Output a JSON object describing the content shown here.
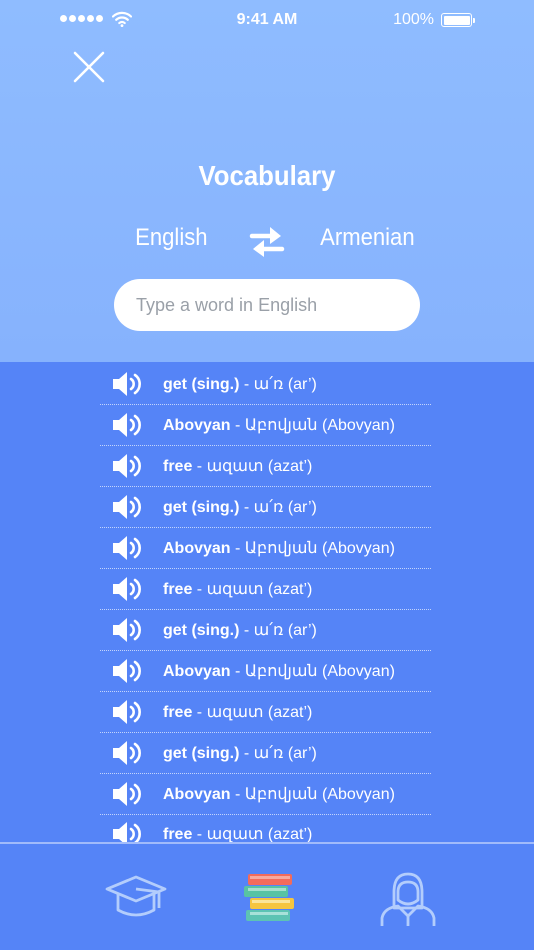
{
  "status_bar": {
    "time": "9:41 AM",
    "battery_percent": "100%",
    "battery_level": 1.0
  },
  "header": {
    "title": "Vocabulary",
    "source_language": "English",
    "target_language": "Armenian",
    "search_placeholder": "Type a word in English"
  },
  "vocab_list": [
    {
      "word": "get (sing.)",
      "rest": " - ա՛ռ (ar’)"
    },
    {
      "word": "Abovyan",
      "rest": " - Աբովյան (Abovyan)"
    },
    {
      "word": "free",
      "rest": " - ազատ (azat’)"
    },
    {
      "word": "get (sing.)",
      "rest": " - ա՛ռ (ar’)"
    },
    {
      "word": "Abovyan",
      "rest": " - Աբովյան (Abovyan)"
    },
    {
      "word": "free",
      "rest": " - ազատ (azat’)"
    },
    {
      "word": "get (sing.)",
      "rest": " - ա՛ռ (ar’)"
    },
    {
      "word": "Abovyan",
      "rest": " - Աբովյան (Abovyan)"
    },
    {
      "word": "free",
      "rest": " - ազատ (azat’)"
    },
    {
      "word": "get (sing.)",
      "rest": " - ա՛ռ (ar’)"
    },
    {
      "word": "Abovyan",
      "rest": " - Աբովյան (Abovyan)"
    },
    {
      "word": "free",
      "rest": " - ազատ (azat’)"
    }
  ],
  "tabs": [
    {
      "icon": "graduation-cap-icon",
      "active": false
    },
    {
      "icon": "books-icon",
      "active": true
    },
    {
      "icon": "person-icon",
      "active": false
    }
  ],
  "colors": {
    "header": "#8fbcff",
    "list_bg": "#5584f7",
    "text": "#ffffff",
    "tab_inactive": "#b3cdfc"
  }
}
